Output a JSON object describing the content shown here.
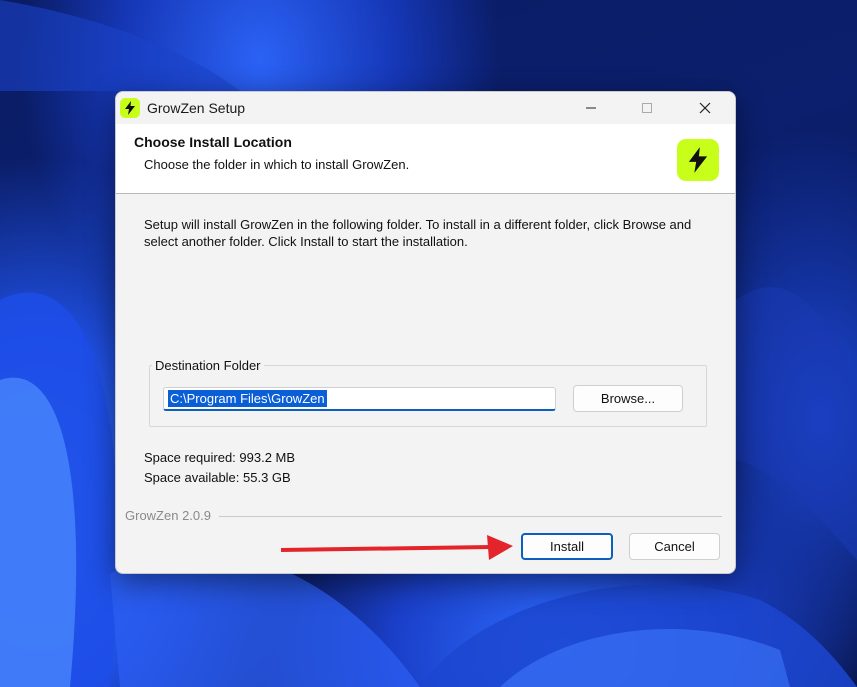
{
  "window": {
    "title": "GrowZen Setup"
  },
  "header": {
    "title": "Choose Install Location",
    "subtitle": "Choose the folder in which to install GrowZen."
  },
  "body": {
    "description": "Setup will install GrowZen in the following folder. To install in a different folder, click Browse and select another folder. Click Install to start the installation.",
    "destination_label": "Destination Folder",
    "destination_path": "C:\\Program Files\\GrowZen",
    "browse_label": "Browse...",
    "space_required": "Space required: 993.2 MB",
    "space_available": "Space available: 55.3 GB"
  },
  "footer": {
    "version": "GrowZen 2.0.9",
    "install_label": "Install",
    "cancel_label": "Cancel"
  },
  "colors": {
    "accent": "#c8ff1a",
    "focus_blue": "#0a5fc0",
    "arrow_red": "#e3242b"
  }
}
